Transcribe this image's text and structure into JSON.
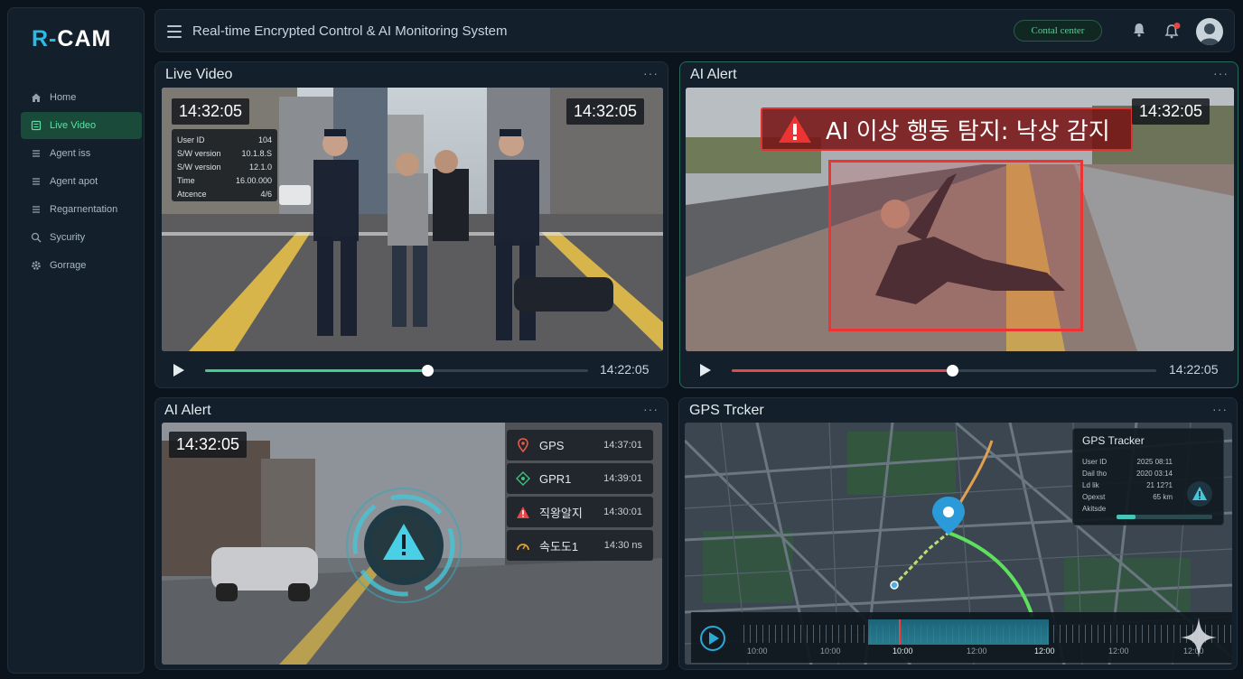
{
  "app": {
    "logo_r": "R-",
    "logo_c": "CAM",
    "title": "Real-time Encrypted Control & AI Monitoring System"
  },
  "sidebar": {
    "items": [
      {
        "label": "Home",
        "icon": "home-icon",
        "active": false
      },
      {
        "label": "Live Video",
        "icon": "video-icon",
        "active": true
      },
      {
        "label": "Agent iss",
        "icon": "list-icon",
        "active": false
      },
      {
        "label": "Agent apot",
        "icon": "list-icon",
        "active": false
      },
      {
        "label": "Regarnentation",
        "icon": "list-icon",
        "active": false
      },
      {
        "label": "Sycurity",
        "icon": "search-icon",
        "active": false
      },
      {
        "label": "Gorrage",
        "icon": "gear-icon",
        "active": false
      }
    ]
  },
  "topbar": {
    "control_center": "Contal center",
    "notification_dot_color": "#e84545"
  },
  "panels": {
    "live_video": {
      "title": "Live Video",
      "more": "···",
      "timestamp_left": "14:32:05",
      "timestamp_right": "14:32:05",
      "info": [
        {
          "k": "User ID",
          "v": "104"
        },
        {
          "k": "S/W version",
          "v": "10.1.8.S"
        },
        {
          "k": "S/W version",
          "v": "12.1.0"
        },
        {
          "k": "Time",
          "v": "16.00.000"
        },
        {
          "k": "Atcence",
          "v": "4/6"
        }
      ],
      "progress": 0.58,
      "progress_color": "#3fd08a",
      "duration": "14:22:05"
    },
    "ai_alert_video": {
      "title": "AI Alert",
      "more": "···",
      "banner": "AI 이상 행동 탐지: 낙상 감지",
      "timestamp": "14:32:05",
      "progress": 0.52,
      "progress_color": "#e04a4a",
      "duration": "14:22:05"
    },
    "ai_alert_events": {
      "title": "AI Alert",
      "more": "···",
      "timestamp": "14:32:05",
      "events": [
        {
          "label": "GPS",
          "time": "14:37:01",
          "icon": "location-pin-icon",
          "color": "#e85a4a"
        },
        {
          "label": "GPR1",
          "time": "14:39:01",
          "icon": "crosshair-icon",
          "color": "#3fbf7f"
        },
        {
          "label": "직왕알지",
          "time": "14:30:01",
          "icon": "warning-icon",
          "color": "#e84545"
        },
        {
          "label": "속도도1",
          "time": "14:30 ns",
          "icon": "speedometer-icon",
          "color": "#e0a030"
        }
      ]
    },
    "gps_tracker": {
      "title": "GPS Trcker",
      "more": "···",
      "card_title": "GPS Tracker",
      "card_rows": [
        {
          "k": "User ID",
          "v": "2025 08:11"
        },
        {
          "k": "Dail tho",
          "v": "2020 03:14"
        },
        {
          "k": "Ld lik",
          "v": "21 12?1"
        },
        {
          "k": "Opexst",
          "v": "65 km"
        },
        {
          "k": "Akitsde",
          "v": ""
        }
      ],
      "altitude_progress": 0.2,
      "timeline_labels": [
        "10:00",
        "10:00",
        "10:00",
        "12:00",
        "12:00",
        "12:00",
        "12:00"
      ]
    }
  }
}
